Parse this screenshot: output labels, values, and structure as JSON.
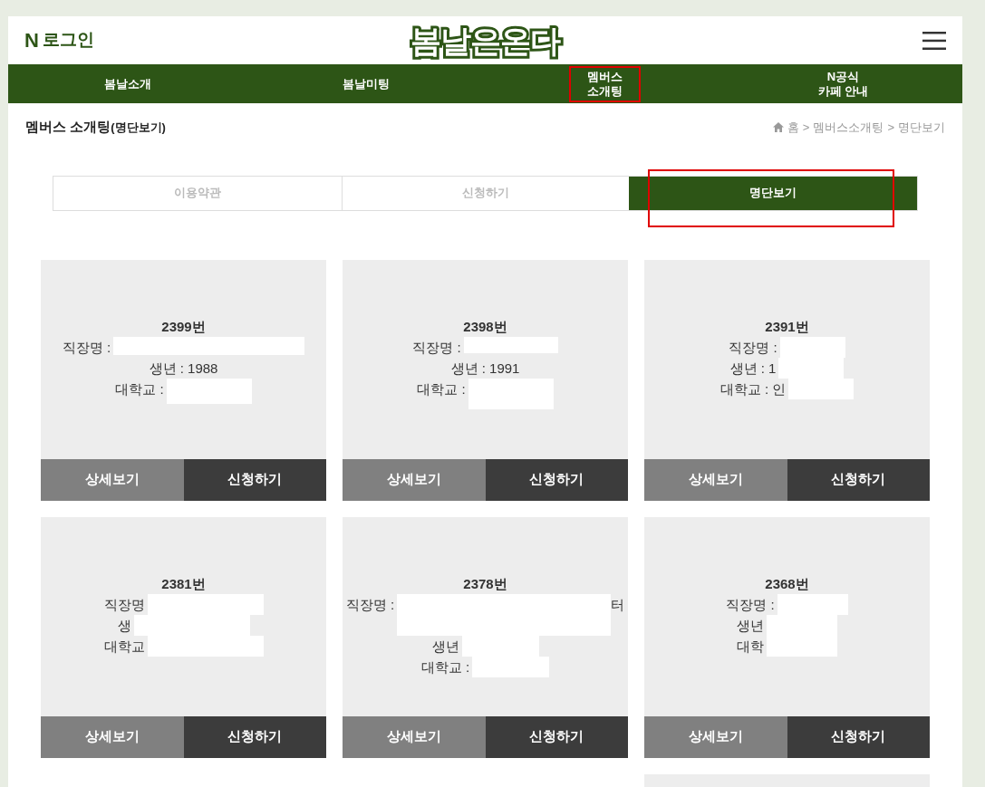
{
  "header": {
    "login": {
      "mark": "N",
      "label": "로그인"
    },
    "logo": "봄날은온다"
  },
  "nav": [
    {
      "label": "봄날소개",
      "highlighted": false
    },
    {
      "label": "봄날미팅",
      "highlighted": false
    },
    {
      "label": "멤버스\n소개팅",
      "highlighted": true
    },
    {
      "label": "N공식\n카페 안내",
      "highlighted": false
    }
  ],
  "page_title": {
    "main": "멤버스 소개팅",
    "sub": "(명단보기)"
  },
  "breadcrumb": [
    "홈",
    "멤버스소개팅",
    "명단보기"
  ],
  "breadcrumb_separator": ">",
  "tabs": [
    {
      "label": "이용약관",
      "selected": false,
      "highlighted": false
    },
    {
      "label": "신청하기",
      "selected": false,
      "highlighted": false
    },
    {
      "label": "명단보기",
      "selected": true,
      "highlighted": true
    }
  ],
  "cards": [
    {
      "number": "2399번",
      "lines": [
        {
          "text": "직장명 :",
          "redacted": true
        },
        {
          "text": "생년 : 1988",
          "redacted": false
        },
        {
          "text": "대학교 :",
          "redacted": true
        }
      ],
      "buttons": [
        "상세보기",
        "신청하기"
      ]
    },
    {
      "number": "2398번",
      "lines": [
        {
          "text": "직장명 :",
          "redacted": true
        },
        {
          "text": "생년 : 1991",
          "redacted": false
        },
        {
          "text": "대학교 :",
          "redacted": true
        }
      ],
      "buttons": [
        "상세보기",
        "신청하기"
      ]
    },
    {
      "number": "2391번",
      "lines": [
        {
          "text": "직장명 :",
          "redacted": true
        },
        {
          "text": "생년 : 1",
          "redacted": true
        },
        {
          "text": "대학교 : 인",
          "redacted": true
        }
      ],
      "buttons": [
        "상세보기",
        "신청하기"
      ]
    },
    {
      "number": "2381번",
      "lines": [
        {
          "text": "직장명",
          "redacted": true
        },
        {
          "text": "생",
          "redacted": true
        },
        {
          "text": "대학교",
          "redacted": true
        }
      ],
      "buttons": [
        "상세보기",
        "신청하기"
      ]
    },
    {
      "number": "2378번",
      "lines": [
        {
          "text": "직장명 :",
          "redacted": true,
          "after": "터"
        },
        {
          "text": "생년",
          "redacted": true
        },
        {
          "text": "대학교 :",
          "redacted": true
        }
      ],
      "buttons": [
        "상세보기",
        "신청하기"
      ]
    },
    {
      "number": "2368번",
      "lines": [
        {
          "text": "직장명 :",
          "redacted": true
        },
        {
          "text": "생년",
          "redacted": true
        },
        {
          "text": "대학",
          "redacted": true
        }
      ],
      "buttons": [
        "상세보기",
        "신청하기"
      ]
    }
  ]
}
